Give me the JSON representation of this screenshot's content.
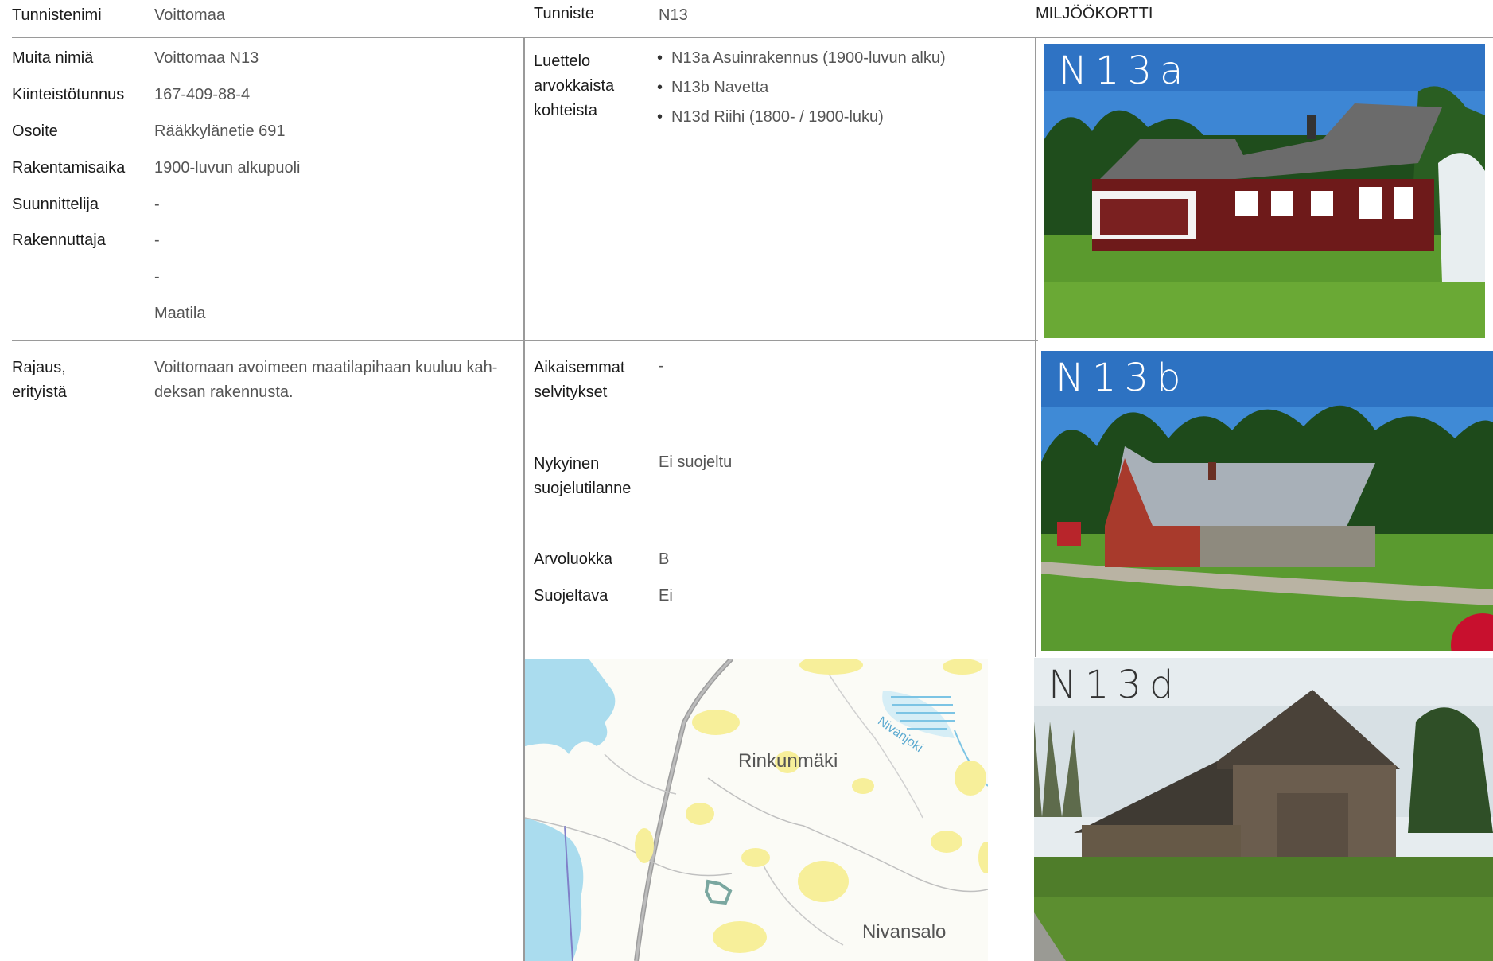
{
  "header": {
    "name_label": "Tunnistenimi",
    "name_value": "Voittomaa",
    "id_label": "Tunniste",
    "id_value": "N13",
    "card_title": "MILJÖÖKORTTI"
  },
  "info": {
    "other_names_label": "Muita nimiä",
    "other_names_value": "Voittomaa N13",
    "property_id_label": "Kiinteistötunnus",
    "property_id_value": "167-409-88-4",
    "address_label": "Osoite",
    "address_value": "Rääkkylänetie 691",
    "built_label": "Rakentamisaika",
    "built_value": "1900-luvun alkupuoli",
    "designer_label": "Suunnittelija",
    "designer_value": "-",
    "builder_label": "Rakennuttaja",
    "builder_value": "-",
    "extra_value_1": "-",
    "extra_value_2": "Maatila"
  },
  "objects": {
    "label": "Luettelo arvokkaista kohteista",
    "items": [
      "N13a Asuinrakennus (1900-luvun alku)",
      "N13b Navetta",
      "N13d Riihi (1800- / 1900-luku)"
    ]
  },
  "boundary": {
    "label": "Rajaus, erityistä",
    "text": "Voittomaan avoimeen maatilapihaan kuuluu kah-deksan rakennusta."
  },
  "status": {
    "prev_label": "Aikaisemmat selvitykset",
    "prev_value": "-",
    "protection_label": "Nykyinen suojelutilanne",
    "protection_value": "Ei suojeltu",
    "class_label": "Arvoluokka",
    "class_value": "B",
    "protect_label": "Suojeltava",
    "protect_value": "Ei"
  },
  "photos": {
    "a": "N13a",
    "b": "N13b",
    "d": "N13d"
  },
  "map": {
    "place_1": "Rinkunmäki",
    "place_2": "Nivansalo",
    "river": "Nivanjoki"
  }
}
